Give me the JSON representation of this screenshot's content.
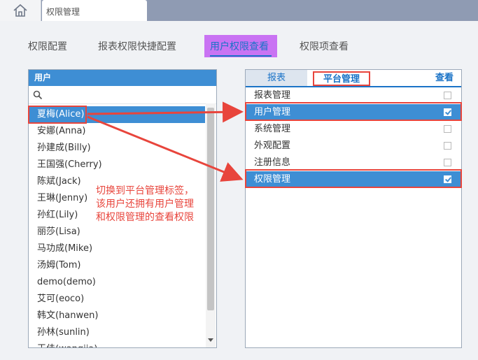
{
  "header": {
    "home_icon": "home-icon",
    "tab_title": "权限管理"
  },
  "nav": {
    "items": [
      "权限配置",
      "报表权限快捷配置",
      "用户权限查看",
      "权限项查看"
    ],
    "active_index": 2
  },
  "user_panel": {
    "title": "用户",
    "search_icon": "search-icon",
    "users": [
      "夏梅(Alice)",
      "安娜(Anna)",
      "孙建成(Billy)",
      "王国强(Cherry)",
      "陈斌(Jack)",
      "王琳(Jenny)",
      "孙红(Lily)",
      "丽莎(Lisa)",
      "马功成(Mike)",
      "汤姆(Tom)",
      "demo(demo)",
      "艾可(eoco)",
      "韩文(hanwen)",
      "孙林(sunlin)",
      "王佳(wangjia)"
    ],
    "selected_index": 0
  },
  "perm_panel": {
    "tabs": {
      "report": "报表",
      "platform": "平台管理",
      "view": "查看"
    },
    "items": [
      {
        "label": "报表管理",
        "checked": false
      },
      {
        "label": "用户管理",
        "checked": true
      },
      {
        "label": "系统管理",
        "checked": false
      },
      {
        "label": "外观配置",
        "checked": false
      },
      {
        "label": "注册信息",
        "checked": false
      },
      {
        "label": "权限管理",
        "checked": true
      }
    ]
  },
  "annotation": {
    "text": "切换到平台管理标签，该用户还拥有用户管理和权限管理的查看权限"
  },
  "colors": {
    "accent": "#3e8ed4",
    "highlight": "#c66cf2",
    "annotation_red": "#e8453c",
    "topbar": "#8f9bb3"
  }
}
